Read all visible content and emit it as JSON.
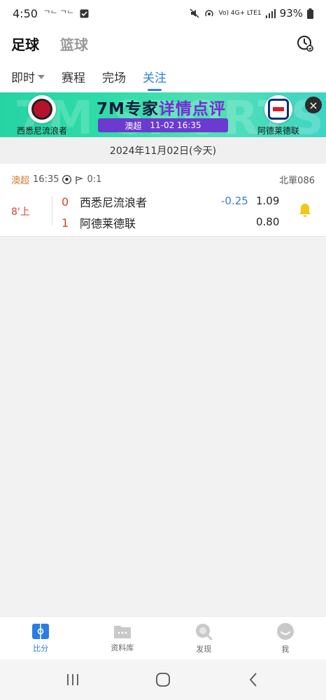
{
  "status_bar": {
    "time": "4:50",
    "carrier_icons": "ᄀᄂ ᄀᄂ",
    "signal_text": "Vo) 4G+ LTE1",
    "battery": "93%"
  },
  "sport_tabs": [
    {
      "label": "足球",
      "active": true
    },
    {
      "label": "篮球",
      "active": false
    }
  ],
  "sub_tabs": [
    {
      "label": "即时",
      "active": false
    },
    {
      "label": "赛程",
      "active": false
    },
    {
      "label": "完场",
      "active": false
    },
    {
      "label": "关注",
      "active": true
    }
  ],
  "banner": {
    "bg_text": "7M SPORTS",
    "title_part1": "7M专家",
    "title_part2": "详情点评",
    "league": "澳超",
    "datetime": "11-02 16:35",
    "home_team": "西悉尼流浪者",
    "away_team": "阿德莱德联",
    "close_label": "×"
  },
  "date_label": "2024年11月02日(今天)",
  "match": {
    "league": "澳超",
    "kickoff": "16:35",
    "corner_score": "0:1",
    "lottery_code": "北單086",
    "status": "8'上",
    "home_score": "0",
    "away_score": "1",
    "home_team": "西悉尼流浪者",
    "away_team": "阿德莱德联",
    "handicap": "-0.25",
    "home_odds": "1.09",
    "away_odds": "0.80"
  },
  "bottom_nav": [
    {
      "label": "比分",
      "icon": "scoreboard-icon",
      "active": true
    },
    {
      "label": "资料库",
      "icon": "folder-icon",
      "active": false
    },
    {
      "label": "发现",
      "icon": "discover-icon",
      "active": false
    },
    {
      "label": "我",
      "icon": "profile-icon",
      "active": false
    }
  ],
  "colors": {
    "accent": "#2a7de1",
    "live_red": "#d9432b",
    "league_orange": "#d07a32",
    "bell_yellow": "#f5c518"
  }
}
